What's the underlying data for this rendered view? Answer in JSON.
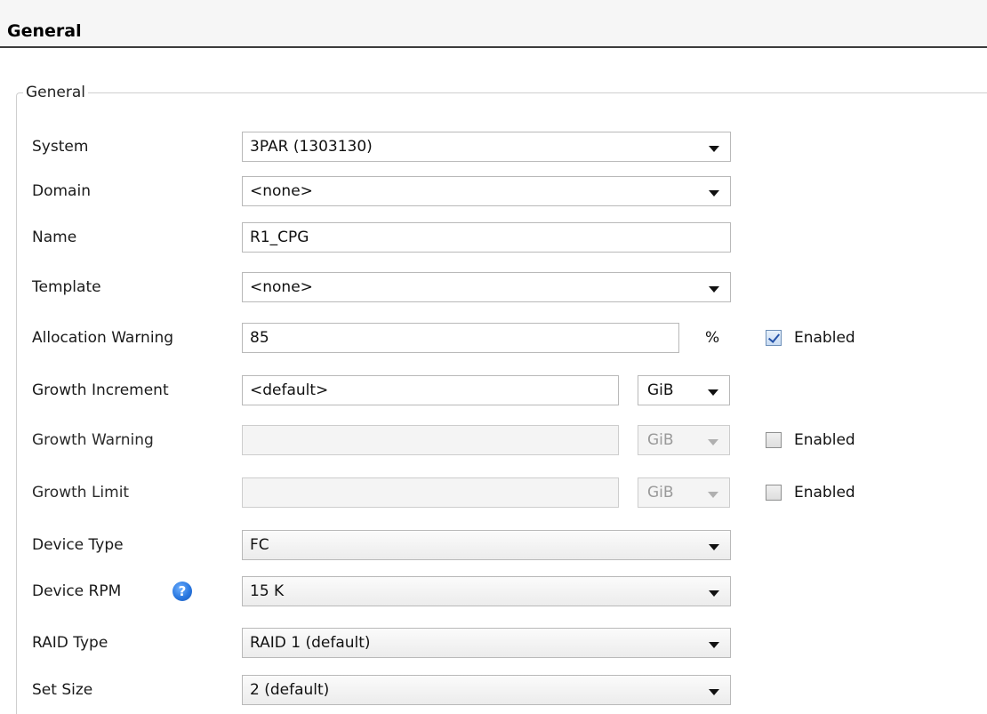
{
  "section_title": "General",
  "group_label": "General",
  "fields": {
    "system": {
      "label": "System",
      "value": "3PAR (1303130)"
    },
    "domain": {
      "label": "Domain",
      "value": "<none>"
    },
    "name": {
      "label": "Name",
      "value": "R1_CPG"
    },
    "template": {
      "label": "Template",
      "value": "<none>"
    },
    "allocation_warning": {
      "label": "Allocation Warning",
      "value": "85",
      "unit": "%",
      "enabled_label": "Enabled",
      "enabled": true
    },
    "growth_increment": {
      "label": "Growth Increment",
      "value": "<default>",
      "unit": "GiB"
    },
    "growth_warning": {
      "label": "Growth Warning",
      "value": "",
      "unit": "GiB",
      "enabled_label": "Enabled",
      "enabled": false
    },
    "growth_limit": {
      "label": "Growth Limit",
      "value": "",
      "unit": "GiB",
      "enabled_label": "Enabled",
      "enabled": false
    },
    "device_type": {
      "label": "Device Type",
      "value": "FC"
    },
    "device_rpm": {
      "label": "Device RPM",
      "value": "15 K",
      "help_icon": "question-mark"
    },
    "raid_type": {
      "label": "RAID Type",
      "value": "RAID 1 (default)"
    },
    "set_size": {
      "label": "Set Size",
      "value": "2 (default)"
    }
  },
  "colors": {
    "help_icon": "#2a78e0",
    "header_rule": "#3c3c3c"
  }
}
